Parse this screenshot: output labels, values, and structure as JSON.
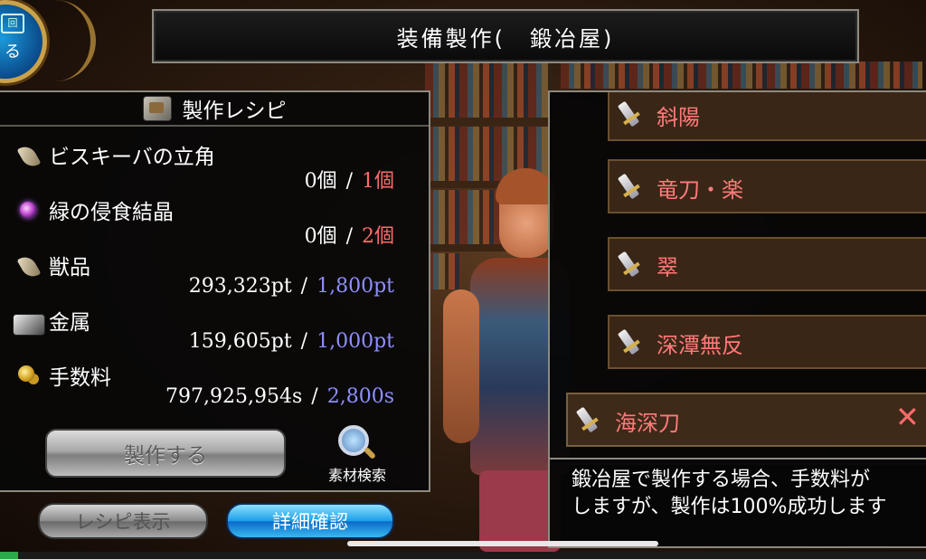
{
  "title": "装備製作(　鍛冶屋)",
  "top_left_button": {
    "label": "る",
    "mini": "回"
  },
  "recipe": {
    "header": "製作レシピ",
    "materials": [
      {
        "name": "ビスキーバの立角",
        "icon": "horn-icon",
        "have": "0個",
        "need": "1個",
        "need_color": "red"
      },
      {
        "name": "緑の侵食結晶",
        "icon": "crystal-icon",
        "have": "0個",
        "need": "2個",
        "need_color": "red"
      },
      {
        "name": "獣品",
        "icon": "claw-icon",
        "have": "293,323pt",
        "need": "1,800pt",
        "need_color": "blue"
      },
      {
        "name": "金属",
        "icon": "metal-ingot-icon",
        "have": "159,605pt",
        "need": "1,000pt",
        "need_color": "blue"
      },
      {
        "name": "手数料",
        "icon": "coins-icon",
        "have": "797,925,954s",
        "need": "2,800s",
        "need_color": "blue"
      }
    ],
    "separator": "/",
    "craft_button": "製作する",
    "search_button": "素材検索"
  },
  "bottom_buttons": {
    "recipe_view": "レシピ表示",
    "details": "詳細確認"
  },
  "weapon_list": [
    {
      "name": "斜陽",
      "selected": false
    },
    {
      "name": "竜刀・楽",
      "selected": false
    },
    {
      "name": "翠",
      "selected": false
    },
    {
      "name": "深潭無反",
      "selected": false
    },
    {
      "name": "海深刀",
      "selected": true
    }
  ],
  "close_symbol": "✕",
  "description": "鍛冶屋で製作する場合、手数料が\nしますが、製作は100%成功します",
  "progress_fraction": 0.02,
  "colors": {
    "need_red": "#ff6b6b",
    "need_blue": "#8f8fff",
    "item_text": "#ff7a7a"
  }
}
